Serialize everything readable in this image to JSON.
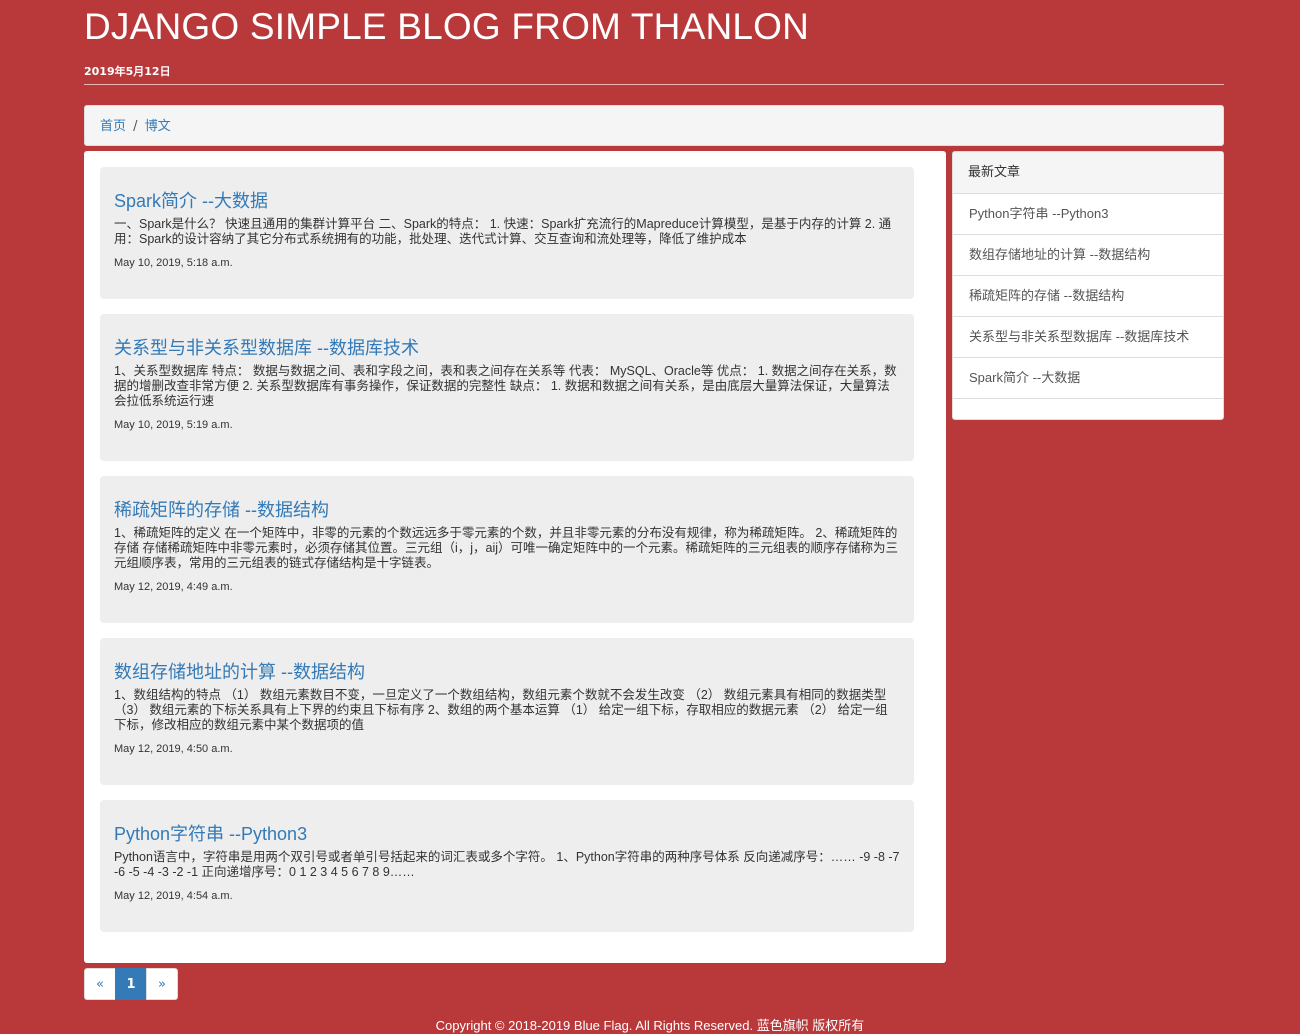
{
  "header": {
    "title": "DJANGO SIMPLE BLOG FROM THANLON",
    "date": "2019年5月12日"
  },
  "breadcrumb": {
    "home": "首页",
    "separator": "/",
    "current": "博文"
  },
  "posts": [
    {
      "title": "Spark简介 --大数据",
      "excerpt": "一、Spark是什么？ 快速且通用的集群计算平台 二、Spark的特点： 1. 快速：Spark扩充流行的Mapreduce计算模型，是基于内存的计算 2. 通用：Spark的设计容纳了其它分布式系统拥有的功能，批处理、迭代式计算、交互查询和流处理等，降低了维护成本",
      "date": "May 10, 2019, 5:18 a.m."
    },
    {
      "title": "关系型与非关系型数据库 --数据库技术",
      "excerpt": "1、关系型数据库 特点： 数据与数据之间、表和字段之间，表和表之间存在关系等 代表： MySQL、Oracle等 优点： 1. 数据之间存在关系，数据的增删改查非常方便 2. 关系型数据库有事务操作，保证数据的完整性 缺点： 1. 数据和数据之间有关系，是由底层大量算法保证，大量算法会拉低系统运行速",
      "date": "May 10, 2019, 5:19 a.m."
    },
    {
      "title": "稀疏矩阵的存储 --数据结构",
      "excerpt": "1、稀疏矩阵的定义 在一个矩阵中，非零的元素的个数远远多于零元素的个数，并且非零元素的分布没有规律，称为稀疏矩阵。 2、稀疏矩阵的存储 存储稀疏矩阵中非零元素时，必须存储其位置。三元组（i，j，aij）可唯一确定矩阵中的一个元素。稀疏矩阵的三元组表的顺序存储称为三元组顺序表，常用的三元组表的链式存储结构是十字链表。",
      "date": "May 12, 2019, 4:49 a.m."
    },
    {
      "title": "数组存储地址的计算 --数据结构",
      "excerpt": "1、数组结构的特点 （1） 数组元素数目不变，一旦定义了一个数组结构，数组元素个数就不会发生改变 （2） 数组元素具有相同的数据类型 （3） 数组元素的下标关系具有上下界的约束且下标有序 2、数组的两个基本运算 （1） 给定一组下标，存取相应的数据元素 （2） 给定一组下标，修改相应的数组元素中某个数据项的值",
      "date": "May 12, 2019, 4:50 a.m."
    },
    {
      "title": "Python字符串 --Python3",
      "excerpt": "Python语言中，字符串是用两个双引号或者单引号括起来的词汇表或多个字符。 1、Python字符串的两种序号体系 反向递减序号：…… -9 -8 -7 -6 -5 -4 -3 -2 -1 正向递增序号：0 1 2 3 4 5 6 7 8 9……",
      "date": "May 12, 2019, 4:54 a.m."
    }
  ],
  "sidebar": {
    "heading": "最新文章",
    "items": [
      "Python字符串 --Python3",
      "数组存储地址的计算 --数据结构",
      "稀疏矩阵的存储 --数据结构",
      "关系型与非关系型数据库 --数据库技术",
      "Spark简介 --大数据"
    ]
  },
  "pagination": {
    "prev": "«",
    "current": "1",
    "next": "»"
  },
  "footer": {
    "text": "Copyright © 2018-2019 Blue Flag. All Rights Reserved. 蓝色旗帜 版权所有"
  },
  "colors": {
    "background": "#b9393b",
    "link": "#337ab7",
    "card": "#eeeeee"
  }
}
